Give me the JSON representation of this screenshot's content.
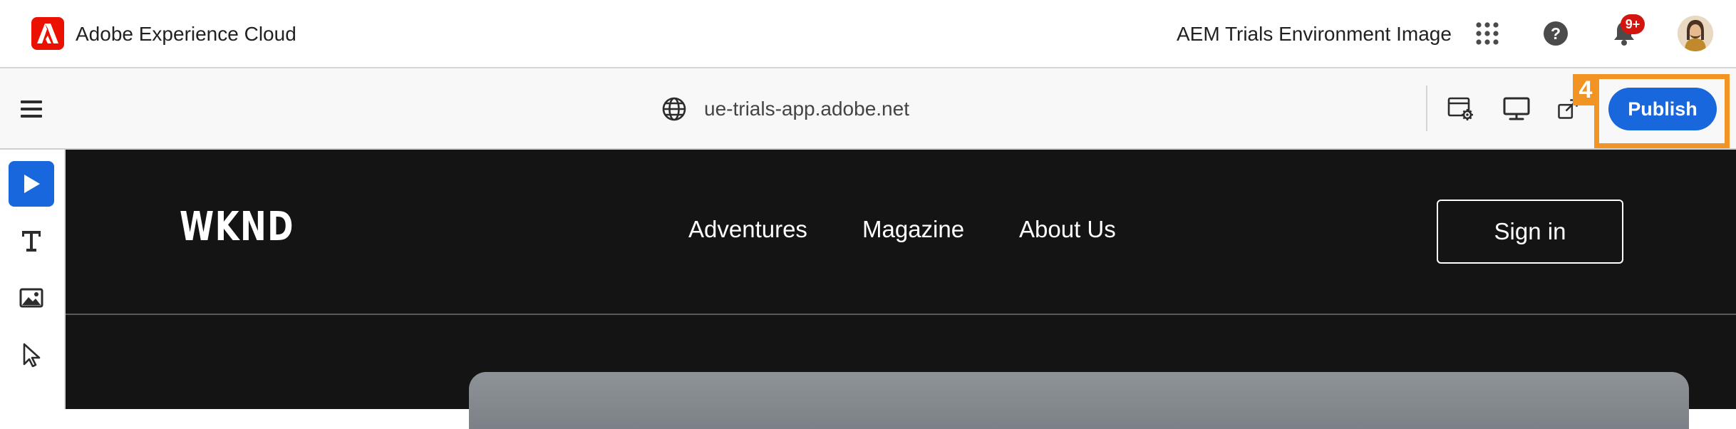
{
  "shell": {
    "brand": "Adobe Experience Cloud",
    "environment": "AEM Trials Environment Image",
    "notification_count": "9+",
    "icons": [
      "adobe-logo-icon",
      "app-switcher-icon",
      "help-icon",
      "bell-icon",
      "avatar"
    ]
  },
  "toolbar": {
    "url": "ue-trials-app.adobe.net",
    "publish_label": "Publish",
    "step_number": "4",
    "icons": [
      "hamburger-menu-icon",
      "globe-icon",
      "page-properties-icon",
      "desktop-icon",
      "open-external-icon"
    ]
  },
  "rail": {
    "tools": [
      "preview-icon",
      "text-icon",
      "image-icon",
      "select-pointer-icon"
    ],
    "active": "preview-icon"
  },
  "site": {
    "logo": "WKND",
    "nav": [
      "Adventures",
      "Magazine",
      "About Us"
    ],
    "sign_in_label": "Sign in"
  },
  "colors": {
    "adobe_red": "#eb1000",
    "publish_blue": "#1867dc",
    "highlight_orange": "#f29423",
    "site_background": "#141414",
    "badge_red": "#d31510"
  }
}
